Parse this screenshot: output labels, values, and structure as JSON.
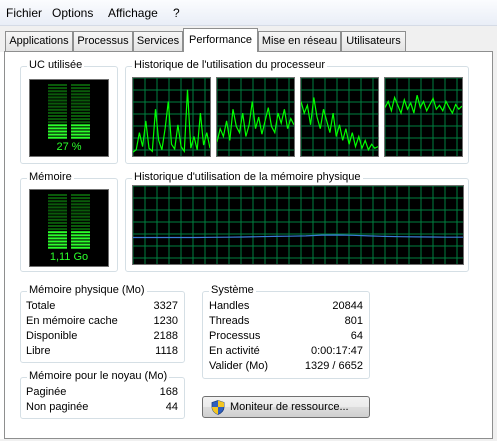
{
  "menu": {
    "items": [
      "Fichier",
      "Options",
      "Affichage",
      "?"
    ]
  },
  "tabs": [
    "Applications",
    "Processus",
    "Services",
    "Performance",
    "Mise en réseau",
    "Utilisateurs"
  ],
  "active_tab": "Performance",
  "cpu": {
    "title": "UC utilisée",
    "value_label": "27 %",
    "percent": 27
  },
  "cpu_history": {
    "title": "Historique de l'utilisation du processeur",
    "cores": [
      [
        5,
        8,
        30,
        12,
        45,
        10,
        6,
        60,
        20,
        8,
        35,
        70,
        15,
        9,
        40,
        12,
        6,
        85,
        10,
        25,
        8,
        55,
        14,
        30,
        10
      ],
      [
        18,
        35,
        25,
        45,
        20,
        60,
        38,
        30,
        55,
        25,
        40,
        70,
        35,
        50,
        28,
        45,
        62,
        38,
        30,
        55,
        42,
        60,
        35,
        48,
        40
      ],
      [
        70,
        55,
        65,
        40,
        75,
        50,
        35,
        60,
        45,
        30,
        55,
        25,
        40,
        20,
        35,
        15,
        30,
        12,
        25,
        10,
        20,
        8,
        15,
        10,
        12
      ],
      [
        62,
        70,
        58,
        75,
        65,
        55,
        72,
        60,
        68,
        55,
        78,
        62,
        70,
        58,
        66,
        74,
        60,
        65,
        58,
        70,
        62,
        55,
        66,
        60,
        64
      ]
    ]
  },
  "memory": {
    "title": "Mémoire",
    "value_label": "1,11 Go",
    "percent": 34
  },
  "memory_history": {
    "title": "Historique d'utilisation de la mémoire physique",
    "values": [
      34,
      34,
      34,
      34,
      34,
      34.2,
      34.4,
      34.6,
      35,
      35.4,
      35.6,
      36,
      37,
      37.2,
      36.8,
      36,
      35.4,
      35,
      34.8,
      34.6,
      34.4,
      34.4
    ]
  },
  "physical_memory": {
    "title": "Mémoire physique (Mo)",
    "rows": [
      {
        "label": "Totale",
        "value": "3327"
      },
      {
        "label": "En mémoire cache",
        "value": "1230"
      },
      {
        "label": "Disponible",
        "value": "2188"
      },
      {
        "label": "Libre",
        "value": "1118"
      }
    ]
  },
  "kernel_memory": {
    "title": "Mémoire pour le noyau (Mo)",
    "rows": [
      {
        "label": "Paginée",
        "value": "168"
      },
      {
        "label": "Non paginée",
        "value": "44"
      }
    ]
  },
  "system": {
    "title": "Système",
    "rows": [
      {
        "label": "Handles",
        "value": "20844"
      },
      {
        "label": "Threads",
        "value": "801"
      },
      {
        "label": "Processus",
        "value": "64"
      },
      {
        "label": "En activité",
        "value": "0:00:17:47"
      },
      {
        "label": "Valider (Mo)",
        "value": "1329 / 6652"
      }
    ]
  },
  "resource_button": {
    "label": "Moniteur de ressource...",
    "icon": "shield-icon"
  },
  "colors": {
    "graph_bg": "#000000",
    "grid": "#008040",
    "cpu_line": "#00ff00",
    "memory_line": "#3a7bd5",
    "gauge_on": "#2bff2b",
    "gauge_off": "#0a5a0a"
  }
}
